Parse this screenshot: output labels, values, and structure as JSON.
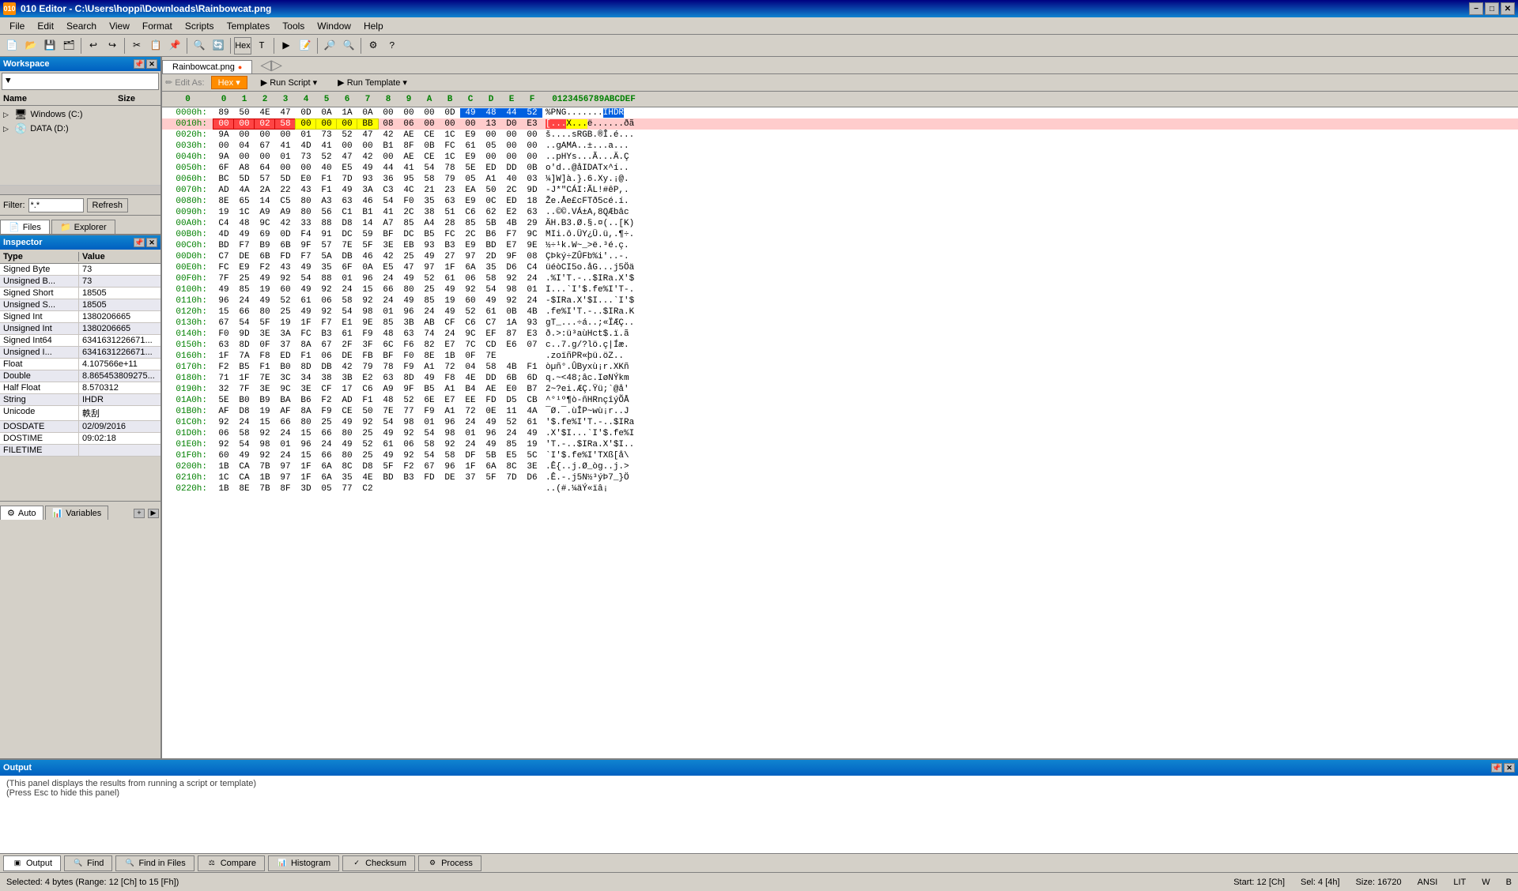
{
  "titlebar": {
    "title": "010 Editor - C:\\Users\\hoppi\\Downloads\\Rainbowcat.png",
    "icon": "010",
    "min_btn": "−",
    "max_btn": "□",
    "close_btn": "✕"
  },
  "menubar": {
    "items": [
      "File",
      "Edit",
      "Search",
      "View",
      "Format",
      "Scripts",
      "Templates",
      "Tools",
      "Window",
      "Help"
    ]
  },
  "workspace": {
    "title": "Workspace",
    "dropdown": "▼",
    "filter_label": "Filter:",
    "filter_value": "*.*",
    "refresh_btn": "Refresh",
    "tabs": [
      {
        "label": "Files",
        "icon": "📄",
        "active": true
      },
      {
        "label": "Explorer",
        "icon": "📁",
        "active": false
      }
    ],
    "tree": [
      {
        "label": "Windows (C:)",
        "icon": "💻",
        "expanded": false,
        "indent": 0
      },
      {
        "label": "DATA (D:)",
        "icon": "💾",
        "expanded": false,
        "indent": 0
      }
    ]
  },
  "inspector": {
    "title": "Inspector",
    "rows": [
      {
        "type": "Signed Byte",
        "value": "73"
      },
      {
        "type": "Unsigned B...",
        "value": "73"
      },
      {
        "type": "Signed Short",
        "value": "18505"
      },
      {
        "type": "Unsigned S...",
        "value": "18505"
      },
      {
        "type": "Signed Int",
        "value": "1380206665"
      },
      {
        "type": "Unsigned Int",
        "value": "1380206665"
      },
      {
        "type": "Signed Int64",
        "value": "6341631226671..."
      },
      {
        "type": "Unsigned I...",
        "value": "6341631226671..."
      },
      {
        "type": "Float",
        "value": "4.107566e+11"
      },
      {
        "type": "Double",
        "value": "8.865453809275..."
      },
      {
        "type": "Half Float",
        "value": "8.570312"
      },
      {
        "type": "String",
        "value": "IHDR"
      },
      {
        "type": "Unicode",
        "value": "軼刮"
      },
      {
        "type": "DOSDATE",
        "value": "02/09/2016"
      },
      {
        "type": "DOSTIME",
        "value": "09:02:18"
      },
      {
        "type": "FILETIME",
        "value": ""
      }
    ],
    "tabs": [
      {
        "label": "Auto",
        "icon": "⚙",
        "active": true
      },
      {
        "label": "Variables",
        "icon": "📊",
        "active": false
      }
    ]
  },
  "hex_editor": {
    "file_tab": "Rainbowcat.png",
    "edit_toolbar": {
      "edit_as": "Edit As:",
      "hex_mode": "Hex ▾",
      "run_script": "Run Script ▾",
      "run_template": "Run Template ▾"
    },
    "columns": {
      "offset": "0",
      "bytes": [
        "0",
        "1",
        "2",
        "3",
        "4",
        "5",
        "6",
        "7",
        "8",
        "9",
        "A",
        "B",
        "C",
        "D",
        "E",
        "F"
      ],
      "ascii_header": "0123456789ABCDEF"
    },
    "rows": [
      {
        "offset": "0000h:",
        "bytes": [
          "89",
          "50",
          "4E",
          "47",
          "0D",
          "0A",
          "1A",
          "0A",
          "00",
          "00",
          "00",
          "0D",
          "49",
          "48",
          "44",
          "52"
        ],
        "ascii": "%PNG.......IHDR",
        "row_class": "normal",
        "sel_bytes": [
          12,
          13,
          14,
          15
        ]
      },
      {
        "offset": "0010h:",
        "bytes": [
          "00",
          "00",
          "02",
          "58",
          "00",
          "00",
          "00",
          "BB",
          "08",
          "06",
          "00",
          "00",
          "00",
          "13",
          "D0",
          "E3"
        ],
        "ascii": "[...X...ë......ðã",
        "row_class": "highlight-red",
        "sel_bytes": [
          0,
          1,
          2,
          3
        ],
        "sel2_bytes": [
          4,
          5,
          6,
          7
        ]
      },
      {
        "offset": "0020h:",
        "bytes": [
          "9A",
          "00",
          "00",
          "00",
          "01",
          "73",
          "52",
          "47",
          "42",
          "AE",
          "CE",
          "1C",
          "E9",
          "00",
          "00",
          "00"
        ],
        "ascii": "š....sRGB.®Î.é...",
        "row_class": "normal",
        "sel_bytes": []
      },
      {
        "offset": "0030h:",
        "bytes": [
          "00",
          "04",
          "67",
          "41",
          "4D",
          "41",
          "00",
          "00",
          "B1",
          "8F",
          "0B",
          "FC",
          "61",
          "05",
          "00",
          "00"
        ],
        "ascii": "..gAMA..±...a...",
        "row_class": "normal",
        "sel_bytes": []
      },
      {
        "offset": "0040h:",
        "bytes": [
          "9A",
          "00",
          "00",
          "01",
          "73",
          "52",
          "47",
          "42",
          "00",
          "AE",
          "CE",
          "1C",
          "E9",
          "00",
          "00",
          "00"
        ],
        "ascii": "..pHYs...Ã...Ä.Ç",
        "row_class": "normal",
        "sel_bytes": []
      },
      {
        "offset": "0050h:",
        "bytes": [
          "6F",
          "A8",
          "64",
          "00",
          "00",
          "40",
          "E5",
          "49",
          "44",
          "41",
          "54",
          "78",
          "5E",
          "ED",
          "DD",
          "0B"
        ],
        "ascii": "o'd..@åIDATx^í..",
        "row_class": "normal",
        "sel_bytes": []
      },
      {
        "offset": "0060h:",
        "bytes": [
          "BC",
          "5D",
          "57",
          "5D",
          "E0",
          "F1",
          "7D",
          "93",
          "36",
          "95",
          "58",
          "79",
          "05",
          "A1",
          "40",
          "03"
        ],
        "ascii": "¼]W]à.}.6.Xy.¡@.",
        "row_class": "normal",
        "sel_bytes": []
      },
      {
        "offset": "0070h:",
        "bytes": [
          "AD",
          "4A",
          "2A",
          "22",
          "43",
          "F1",
          "49",
          "3A",
          "C3",
          "4C",
          "21",
          "23",
          "EA",
          "50",
          "2C",
          "9D"
        ],
        "ascii": "-J*\"CÁI:ÃL!#êP,.",
        "row_class": "normal",
        "sel_bytes": []
      },
      {
        "offset": "0080h:",
        "bytes": [
          "8E",
          "65",
          "14",
          "C5",
          "80",
          "A3",
          "63",
          "46",
          "54",
          "F0",
          "35",
          "63",
          "E9",
          "0C",
          "ED",
          "18"
        ],
        "ascii": "Že.Åe£cFTð5cé.í.",
        "row_class": "normal",
        "sel_bytes": []
      },
      {
        "offset": "0090h:",
        "bytes": [
          "19",
          "1C",
          "A9",
          "A9",
          "80",
          "56",
          "C1",
          "B1",
          "41",
          "2C",
          "38",
          "51",
          "C6",
          "62",
          "E2",
          "63"
        ],
        "ascii": "..©©.VÁ±A,8QÆbâc",
        "row_class": "normal",
        "sel_bytes": []
      },
      {
        "offset": "00A0h:",
        "bytes": [
          "C4",
          "48",
          "9C",
          "42",
          "33",
          "88",
          "D8",
          "14",
          "A7",
          "85",
          "A4",
          "28",
          "85",
          "5B",
          "4B",
          "29"
        ],
        "ascii": "ÄH.B3.Ø.§.¤(..[K)",
        "row_class": "normal",
        "sel_bytes": []
      },
      {
        "offset": "00B0h:",
        "bytes": [
          "4D",
          "49",
          "69",
          "0D",
          "F4",
          "91",
          "DC",
          "59",
          "BF",
          "DC",
          "B5",
          "FC",
          "2C",
          "B6",
          "F7",
          "9C"
        ],
        "ascii": "MIi.ô.ÜY¿Ü.ü,.¶÷.",
        "row_class": "normal",
        "sel_bytes": []
      },
      {
        "offset": "00C0h:",
        "bytes": [
          "BD",
          "F7",
          "B9",
          "6B",
          "9F",
          "57",
          "7E",
          "5F",
          "3E",
          "EB",
          "93",
          "B3",
          "E9",
          "BD",
          "E7",
          "9E"
        ],
        "ascii": "½÷¹k.W~_>ë.³é.ç.",
        "row_class": "normal",
        "sel_bytes": []
      },
      {
        "offset": "00D0h:",
        "bytes": [
          "C7",
          "DE",
          "6B",
          "FD",
          "F7",
          "5A",
          "DB",
          "46",
          "42",
          "25",
          "49",
          "27",
          "97",
          "2D",
          "9F",
          "08"
        ],
        "ascii": "ÇÞký÷ZÛFb%i'..-.",
        "row_class": "normal",
        "sel_bytes": []
      },
      {
        "offset": "00E0h:",
        "bytes": [
          "FC",
          "E9",
          "F2",
          "43",
          "49",
          "35",
          "6F",
          "0A",
          "E5",
          "47",
          "97",
          "1F",
          "6A",
          "35",
          "D6",
          "C4"
        ],
        "ascii": "üéòCI5o.åG...j5Öä",
        "row_class": "normal",
        "sel_bytes": []
      },
      {
        "offset": "00F0h:",
        "bytes": [
          "7F",
          "25",
          "49",
          "92",
          "54",
          "88",
          "01",
          "96",
          "24",
          "49",
          "52",
          "61",
          "06",
          "58",
          "92",
          "24"
        ],
        "ascii": ".%I'T.-..$IRa.X'$",
        "row_class": "normal",
        "sel_bytes": []
      },
      {
        "offset": "0100h:",
        "bytes": [
          "49",
          "85",
          "19",
          "60",
          "49",
          "92",
          "24",
          "15",
          "66",
          "80",
          "25",
          "49",
          "92",
          "54",
          "98",
          "01"
        ],
        "ascii": "I...`I'$.fe%I'T-.",
        "row_class": "normal",
        "sel_bytes": []
      },
      {
        "offset": "0110h:",
        "bytes": [
          "96",
          "24",
          "49",
          "52",
          "61",
          "06",
          "58",
          "92",
          "24",
          "49",
          "85",
          "19",
          "60",
          "49",
          "92",
          "24"
        ],
        "ascii": "-$IRa.X'$I...`I'$",
        "row_class": "normal",
        "sel_bytes": []
      },
      {
        "offset": "0120h:",
        "bytes": [
          "15",
          "66",
          "80",
          "25",
          "49",
          "92",
          "54",
          "98",
          "01",
          "96",
          "24",
          "49",
          "52",
          "61",
          "0B",
          "4B"
        ],
        "ascii": ".fe%I'T.-..$IRa.K",
        "row_class": "normal",
        "sel_bytes": []
      },
      {
        "offset": "0130h:",
        "bytes": [
          "67",
          "54",
          "5F",
          "19",
          "1F",
          "F7",
          "E1",
          "9E",
          "85",
          "3B",
          "AB",
          "CF",
          "C6",
          "C7",
          "1A",
          "93"
        ],
        "ascii": "gT_...÷á..;«ÏÆÇ..",
        "row_class": "normal",
        "sel_bytes": []
      },
      {
        "offset": "0140h:",
        "bytes": [
          "F0",
          "9D",
          "3E",
          "3A",
          "FC",
          "B3",
          "61",
          "F9",
          "48",
          "63",
          "74",
          "24",
          "9C",
          "EF",
          "87",
          "E3"
        ],
        "ascii": "ð.>:ü³aùHct$.ï.ã",
        "row_class": "normal",
        "sel_bytes": []
      },
      {
        "offset": "0150h:",
        "bytes": [
          "63",
          "8D",
          "0F",
          "37",
          "8A",
          "67",
          "2F",
          "3F",
          "6C",
          "F6",
          "82",
          "E7",
          "7C",
          "CD",
          "E6",
          "07"
        ],
        "ascii": "c..7.g/?lö.ç|Íæ.",
        "row_class": "normal",
        "sel_bytes": []
      },
      {
        "offset": "0160h:",
        "bytes": [
          "1F",
          "7A",
          "F8",
          "ED",
          "F1",
          "06",
          "DE",
          "FB",
          "BF",
          "F0",
          "8E",
          "1B",
          "0F",
          "7E"
        ],
        "ascii": ".zoïñPR«þü.öZ..",
        "row_class": "normal",
        "sel_bytes": []
      },
      {
        "offset": "0170h:",
        "bytes": [
          "F2",
          "B5",
          "F1",
          "B0",
          "8D",
          "DB",
          "42",
          "79",
          "78",
          "F9",
          "A1",
          "72",
          "04",
          "58",
          "4B",
          "F1"
        ],
        "ascii": "òµñ°.ÛByxù¡r.XKñ",
        "row_class": "normal",
        "sel_bytes": []
      },
      {
        "offset": "0180h:",
        "bytes": [
          "71",
          "1F",
          "7E",
          "3C",
          "34",
          "38",
          "3B",
          "E2",
          "63",
          "8D",
          "49",
          "F8",
          "4E",
          "DD",
          "6B",
          "6D"
        ],
        "ascii": "q.~<48;âc.IøNÝkm",
        "row_class": "normal",
        "sel_bytes": []
      },
      {
        "offset": "0190h:",
        "bytes": [
          "32",
          "7F",
          "3E",
          "9C",
          "3E",
          "CF",
          "17",
          "C6",
          "A9",
          "9F",
          "B5",
          "A1",
          "B4",
          "AE",
          "E0",
          "B7"
        ],
        "ascii": "2~?ei.ÆÇ.Ÿü;`@å'",
        "row_class": "normal",
        "sel_bytes": []
      },
      {
        "offset": "01A0h:",
        "bytes": [
          "5E",
          "B0",
          "B9",
          "BA",
          "B6",
          "F2",
          "AD",
          "F1",
          "48",
          "52",
          "6E",
          "E7",
          "EE",
          "FD",
          "D5",
          "CB"
        ],
        "ascii": "^°¹º¶ò-ñHRnçîýÕÅ",
        "row_class": "normal",
        "sel_bytes": []
      },
      {
        "offset": "01B0h:",
        "bytes": [
          "AF",
          "D8",
          "19",
          "AF",
          "8A",
          "F9",
          "CE",
          "50",
          "7E",
          "77",
          "F9",
          "A1",
          "72",
          "0E",
          "11",
          "4A"
        ],
        "ascii": "¯Ø.¯.ùÎP~wù¡r..J",
        "row_class": "normal",
        "sel_bytes": []
      },
      {
        "offset": "01C0h:",
        "bytes": [
          "92",
          "24",
          "15",
          "66",
          "80",
          "25",
          "49",
          "92",
          "54",
          "98",
          "01",
          "96",
          "24",
          "49",
          "52",
          "61"
        ],
        "ascii": "'$.fe%I'T.-..$IRa",
        "row_class": "normal",
        "sel_bytes": []
      },
      {
        "offset": "01D0h:",
        "bytes": [
          "06",
          "58",
          "92",
          "24",
          "15",
          "66",
          "80",
          "25",
          "49",
          "92",
          "54",
          "98",
          "01",
          "96",
          "24",
          "49"
        ],
        "ascii": ".X'$I...`I'$.fe%I",
        "row_class": "normal",
        "sel_bytes": []
      },
      {
        "offset": "01E0h:",
        "bytes": [
          "92",
          "54",
          "98",
          "01",
          "96",
          "24",
          "49",
          "52",
          "61",
          "06",
          "58",
          "92",
          "24",
          "49",
          "85",
          "19"
        ],
        "ascii": "'T.-..$IRa.X'$I..",
        "row_class": "normal",
        "sel_bytes": []
      },
      {
        "offset": "01F0h:",
        "bytes": [
          "60",
          "49",
          "92",
          "24",
          "15",
          "66",
          "80",
          "25",
          "49",
          "92",
          "54",
          "58",
          "DF",
          "5B",
          "E5",
          "5C"
        ],
        "ascii": "`I'$.fe%I'TXß[å\\",
        "row_class": "normal",
        "sel_bytes": []
      },
      {
        "offset": "0200h:",
        "bytes": [
          "1B",
          "CA",
          "7B",
          "97",
          "1F",
          "6A",
          "8C",
          "D8",
          "5F",
          "F2",
          "67",
          "96",
          "1F",
          "6A",
          "8C",
          "3E"
        ],
        "ascii": ".Ê{..j.Ø_òg..j.>",
        "row_class": "normal",
        "sel_bytes": []
      },
      {
        "offset": "0210h:",
        "bytes": [
          "1C",
          "CA",
          "1B",
          "97",
          "1F",
          "6A",
          "35",
          "4E",
          "BD",
          "B3",
          "FD",
          "DE",
          "37",
          "5F",
          "7D",
          "D6"
        ],
        "ascii": ".Ê.-.j5N½³ýÞ7_}Ö",
        "row_class": "normal",
        "sel_bytes": []
      },
      {
        "offset": "0220h:",
        "bytes": [
          "1B",
          "8E",
          "7B",
          "8F",
          "3D",
          "05",
          "77",
          "C2"
        ],
        "ascii": "..(#.¼äÝ«ïâ¡",
        "row_class": "normal",
        "sel_bytes": []
      }
    ]
  },
  "output": {
    "title": "Output",
    "line1": "(This panel displays the results from running a script or template)",
    "line2": "(Press Esc to hide this panel)"
  },
  "status_bar": {
    "selected_info": "Selected: 4 bytes (Range: 12 [Ch] to 15 [Fh])",
    "start": "Start: 12 [Ch]",
    "sel": "Sel: 4 [4h]",
    "size": "Size: 16720",
    "encoding": "ANSI",
    "lit": "LIT",
    "w": "W",
    "b": "B"
  },
  "bottom_tabs": [
    {
      "label": "Output",
      "icon": "📋",
      "active": true
    },
    {
      "label": "Find",
      "icon": "🔍",
      "active": false
    },
    {
      "label": "Find in Files",
      "icon": "🔍",
      "active": false
    },
    {
      "label": "Compare",
      "icon": "⚖",
      "active": false
    },
    {
      "label": "Histogram",
      "icon": "📊",
      "active": false
    },
    {
      "label": "Checksum",
      "icon": "✓",
      "active": false
    },
    {
      "label": "Process",
      "icon": "⚙",
      "active": false
    }
  ]
}
